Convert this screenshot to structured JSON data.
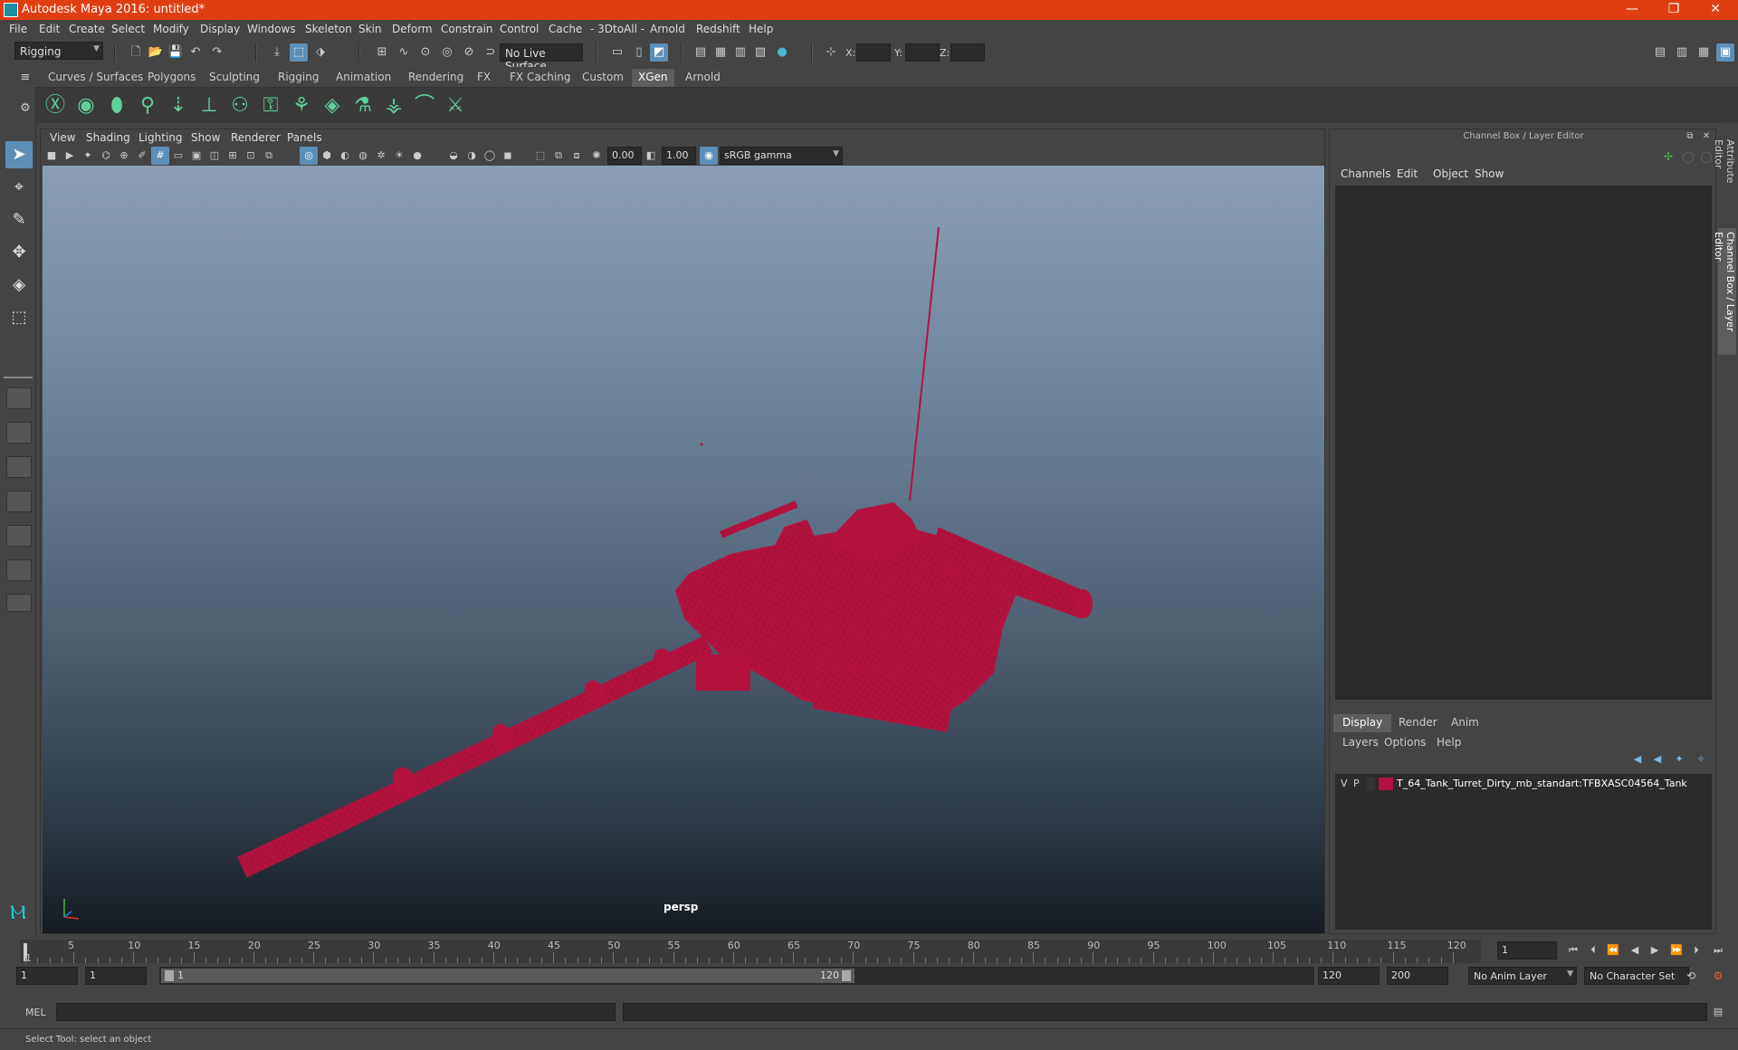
{
  "window": {
    "title": "Autodesk Maya 2016: untitled*"
  },
  "menus": [
    "File",
    "Edit",
    "Create",
    "Select",
    "Modify",
    "Display",
    "Windows",
    "Skeleton",
    "Skin",
    "Deform",
    "Constrain",
    "Control",
    "Cache",
    "- 3DtoAll -",
    "Arnold",
    "Redshift",
    "Help"
  ],
  "status": {
    "menuset": "Rigging",
    "live_surface": "No Live Surface",
    "x_label": "X:",
    "y_label": "Y:",
    "z_label": "Z:"
  },
  "shelf_tabs": [
    "Curves / Surfaces",
    "Polygons",
    "Sculpting",
    "Rigging",
    "Animation",
    "Rendering",
    "FX",
    "FX Caching",
    "Custom",
    "XGen",
    "Arnold"
  ],
  "shelf_active": "XGen",
  "viewport": {
    "menu": [
      "View",
      "Shading",
      "Lighting",
      "Show",
      "Renderer",
      "Panels"
    ],
    "exposure": "0.00",
    "gamma": "1.00",
    "colorspace": "sRGB gamma",
    "camera": "persp"
  },
  "channel_box": {
    "header": "Channel Box / Layer Editor",
    "menu": [
      "Channels",
      "Edit",
      "Object",
      "Show"
    ]
  },
  "layer_editor": {
    "tabs": [
      "Display",
      "Render",
      "Anim"
    ],
    "active_tab": "Display",
    "menu": [
      "Layers",
      "Options",
      "Help"
    ],
    "layers": [
      {
        "v": "V",
        "p": "P",
        "color": "#b3123f",
        "name": "T_64_Tank_Turret_Dirty_mb_standart:TFBXASC04564_Tank"
      }
    ]
  },
  "side_tabs": [
    "Attribute Editor",
    "Channel Box / Layer Editor"
  ],
  "time_slider": {
    "tick_labels": [
      "5",
      "10",
      "15",
      "20",
      "25",
      "30",
      "35",
      "40",
      "45",
      "50",
      "55",
      "60",
      "65",
      "70",
      "75",
      "80",
      "85",
      "90",
      "95",
      "100",
      "105",
      "110",
      "115",
      "120"
    ],
    "start_label": "1",
    "current_frame": "1"
  },
  "range": {
    "start": "1",
    "playback_start": "1",
    "range_start": "1",
    "range_end": "120",
    "playback_end": "120",
    "end": "200",
    "anim_layer": "No Anim Layer",
    "character_set": "No Character Set"
  },
  "command": {
    "label": "MEL"
  },
  "help": {
    "text": "Select Tool: select an object"
  },
  "colors": {
    "titlebar": "#e03e12",
    "accent": "#5c8fb8",
    "model": "#b3123f"
  }
}
